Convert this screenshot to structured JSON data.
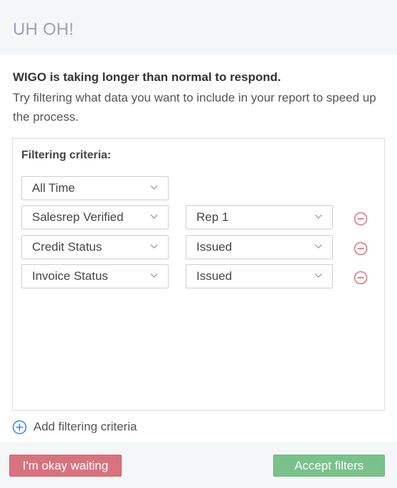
{
  "header": {
    "title": "UH OH!"
  },
  "message": {
    "bold": "WIGO is taking longer than normal to respond.",
    "text": "Try filtering what data you want to include in your report to speed up the process."
  },
  "criteria": {
    "label": "Filtering criteria:",
    "time_select": "All Time",
    "rows": [
      {
        "field": "Salesrep Verified",
        "value": "Rep 1"
      },
      {
        "field": "Credit Status",
        "value": "Issued"
      },
      {
        "field": "Invoice Status",
        "value": "Issued"
      }
    ],
    "add_label": "Add filtering criteria"
  },
  "footer": {
    "wait_label": "I'm okay waiting",
    "accept_label": "Accept filters"
  },
  "colors": {
    "header_text": "#9aa3b5",
    "remove_icon": "#e0787f",
    "add_icon": "#3b7fe0",
    "wait_button": "#d8737e",
    "accept_button": "#79c28c"
  },
  "icons": {
    "dropdown": "chevron-down-icon",
    "remove": "minus-circle-icon",
    "add": "plus-circle-icon"
  }
}
